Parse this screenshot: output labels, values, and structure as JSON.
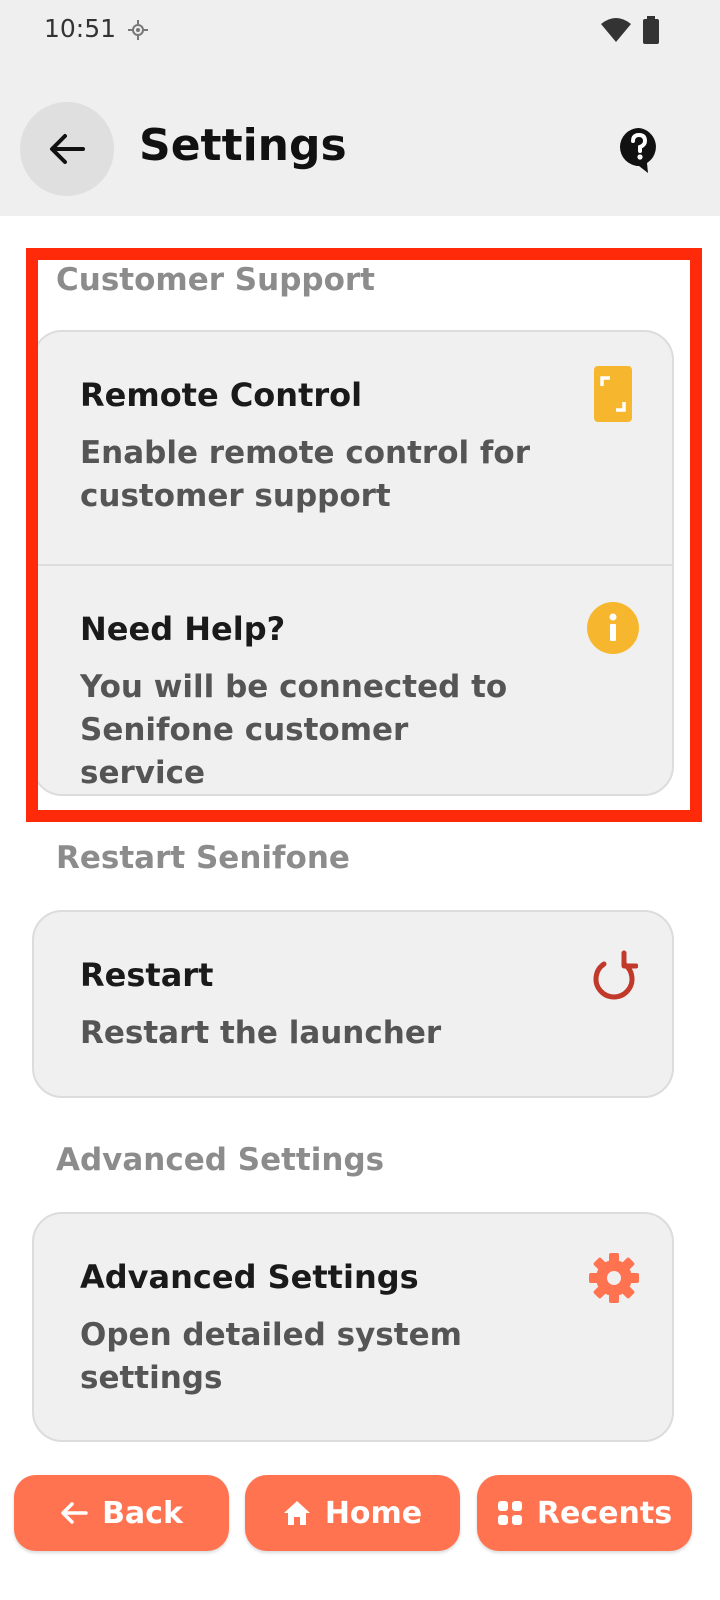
{
  "status_bar": {
    "time": "10:51"
  },
  "header": {
    "title": "Settings"
  },
  "sections": {
    "customer_support": {
      "title": "Customer Support",
      "remote_control": {
        "title": "Remote Control",
        "subtitle": "Enable remote control for customer support"
      },
      "need_help": {
        "title": "Need Help?",
        "subtitle": "You will be connected to Senifone customer service"
      }
    },
    "restart": {
      "title": "Restart Senifone",
      "restart_item": {
        "title": "Restart",
        "subtitle": "Restart the launcher"
      }
    },
    "advanced": {
      "title": "Advanced Settings",
      "advanced_item": {
        "title": "Advanced Settings",
        "subtitle": "Open detailed system settings"
      }
    }
  },
  "bottom_nav": {
    "back": "Back",
    "home": "Home",
    "recents": "Recents"
  },
  "colors": {
    "accent": "#ff7350",
    "highlight": "#ff2a0a",
    "remote_icon": "#f6b62e",
    "info_icon": "#f6b62e",
    "restart_icon": "#c0392b",
    "gear_icon": "#ff7350"
  },
  "icons": [
    "location-icon",
    "wifi-icon",
    "battery-icon",
    "back-arrow-icon",
    "help-icon",
    "remote-control-icon",
    "info-icon",
    "restart-icon",
    "gear-icon",
    "home-icon",
    "recents-icon"
  ]
}
